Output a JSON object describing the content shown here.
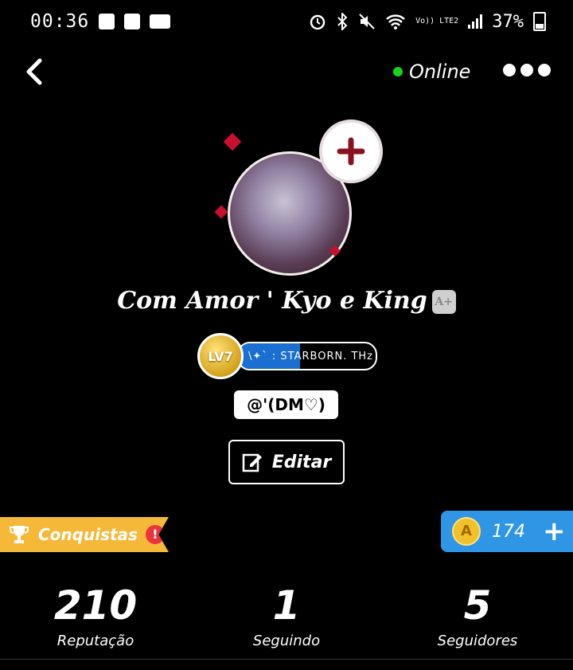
{
  "status_bar": {
    "time": "00:36",
    "volte": "Vo)) LTE2",
    "battery": "37%"
  },
  "header": {
    "online_label": "Online"
  },
  "profile": {
    "name": "Com Amor ' Kyo e King",
    "level_badge": "LV7",
    "level_title": "\\✦` : STARBORN. THz",
    "level_progress": 0.45,
    "handle": "@'(DM♡)",
    "edit_label": "Editar"
  },
  "achievements": {
    "label": "Conquistas",
    "alert": "!"
  },
  "coins": {
    "count": "174",
    "coin_symbol": "A",
    "plus": "+"
  },
  "stats": [
    {
      "value": "210",
      "label": "Reputação"
    },
    {
      "value": "1",
      "label": "Seguindo"
    },
    {
      "value": "5",
      "label": "Seguidores"
    }
  ],
  "colors": {
    "background": "#000000",
    "online_dot": "#19d219",
    "achievement_banner": "#f6b838",
    "coin_panel": "#2f96e6",
    "level_fill": "#1a6fd1"
  }
}
